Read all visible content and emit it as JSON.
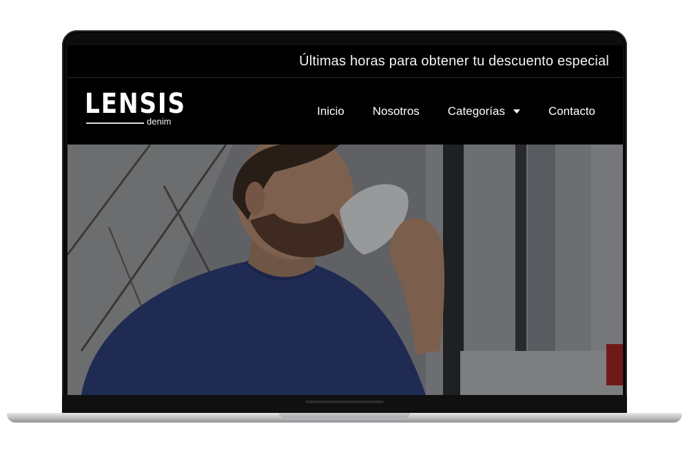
{
  "promo": {
    "text": "Últimas horas para obtener tu descuento especial"
  },
  "brand": {
    "name": "LENSIS",
    "tagline": "denim"
  },
  "nav": {
    "items": [
      {
        "label": "Inicio"
      },
      {
        "label": "Nosotros"
      },
      {
        "label": "Categorías",
        "has_dropdown": true
      },
      {
        "label": "Contacto"
      }
    ]
  },
  "hero": {
    "image_subject": "man-drinking-coffee-photo"
  },
  "colors": {
    "header_bg": "#000000",
    "text": "#ffffff"
  }
}
